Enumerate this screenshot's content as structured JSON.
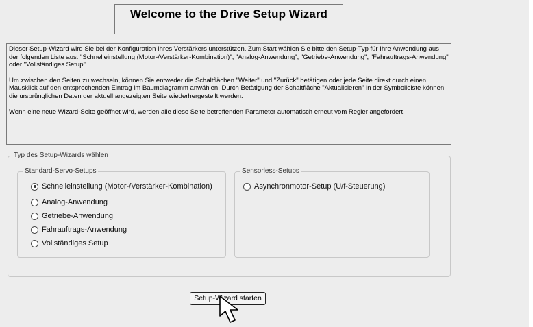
{
  "title": "Welcome to the Drive Setup Wizard",
  "intro": {
    "paragraphs": [
      "Dieser Setup-Wizard wird Sie bei der Konfiguration Ihres Verstärkers unterstützen. Zum Start wählen Sie bitte den Setup-Typ für Ihre Anwendung aus der folgenden Liste aus: \"Schnelleinstellung (Motor-/Verstärker-Kombination)\", \"Analog-Anwendung\", \"Getriebe-Anwendung\", \"Fahrauftrags-Anwendung\" oder \"Vollständiges Setup\".",
      "Um zwischen den Seiten zu wechseln, können Sie entweder die Schaltflächen \"Weiter\" und \"Zurück\" betätigen oder jede Seite direkt durch einen Mausklick auf den entsprechenden Eintrag im Baumdiagramm anwählen. Durch Betätigung der Schaltfläche \"Aktualisieren\" in der Symbolleiste können die ursprünglichen Daten der aktuell angezeigten Seite wiederhergestellt werden.",
      "Wenn eine neue Wizard-Seite geöffnet wird, werden alle diese Seite betreffenden Parameter automatisch erneut vom Regler angefordert."
    ]
  },
  "wizard_type": {
    "label": "Typ des Setup-Wizards wählen",
    "standard": {
      "label": "Standard-Servo-Setups",
      "options": [
        {
          "label": "Schnelleinstellung (Motor-/Verstärker-Kombination)",
          "selected": true
        },
        {
          "label": "Analog-Anwendung",
          "selected": false
        },
        {
          "label": "Getriebe-Anwendung",
          "selected": false
        },
        {
          "label": "Fahrauftrags-Anwendung",
          "selected": false
        },
        {
          "label": "Vollständiges Setup",
          "selected": false
        }
      ]
    },
    "sensorless": {
      "label": "Sensorless-Setups",
      "options": [
        {
          "label": "Asynchronmotor-Setup (U/f-Steuerung)",
          "selected": false
        }
      ]
    }
  },
  "start_button": "Setup-Wizard starten",
  "icons": {
    "cursor": "arrow-cursor-icon"
  }
}
